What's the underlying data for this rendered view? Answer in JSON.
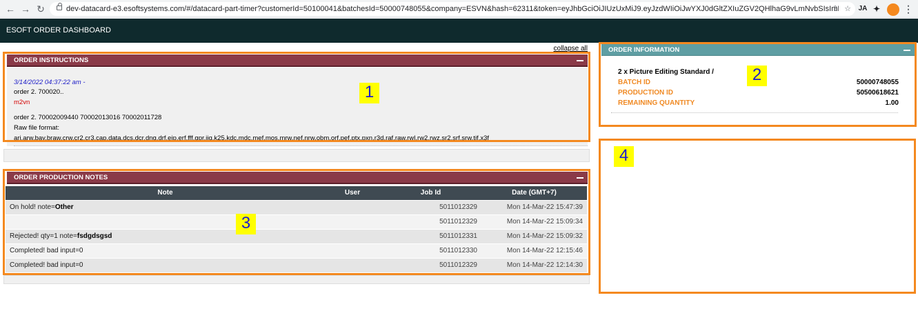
{
  "browser": {
    "url": "dev-datacard-e3.esoftsystems.com/#/datacard-part-timer?customerId=50100041&batchesId=50000748055&company=ESVN&hash=62311&token=eyJhbGciOiJIUzUxMiJ9.eyJzdWIiOiJwYXJ0dGltZXIuZGV2QHlhaG9vLmNvbSIsImF1ZCI...",
    "ext_label": "JA"
  },
  "app": {
    "title": "ESOFT ORDER DASHBOARD",
    "collapse_all": "collapse all"
  },
  "markers": {
    "m1": "1",
    "m2": "2",
    "m3": "3",
    "m4": "4"
  },
  "instructions": {
    "header": "Order Instructions",
    "timestamp": "3/14/2022 04:37:22 am -",
    "line1": "order 2. 700020..",
    "author": "m2vn",
    "line2": "order 2. 70002009440 70002013016 70002011728",
    "line3": "Raw file format:",
    "line4": "ari,arw,bay,braw,crw,cr2,cr3,cap,data,dcs,dcr,dng,drf,eip,erf,fff,gpr,iiq,k25,kdc,mdc,mef,mos,mrw,nef,nrw,obm,orf,pef,ptx,pxn,r3d,raf,raw,rwl,rw2,rwz,sr2,srf,srw,tif,x3f"
  },
  "notes": {
    "header": "Order Production Notes",
    "columns": {
      "note": "Note",
      "user": "User",
      "job": "Job Id",
      "date": "Date (GMT+7)"
    },
    "rows": [
      {
        "prefix": "On hold! note=",
        "bold": "Other",
        "user": "",
        "job": "5011012329",
        "date": "Mon 14-Mar-22 15:47:39"
      },
      {
        "prefix": "",
        "bold": "",
        "user": "",
        "job": "5011012329",
        "date": "Mon 14-Mar-22 15:09:34"
      },
      {
        "prefix": "Rejected! qty=1 note=",
        "bold": "fsdgdsgsd",
        "user": "",
        "job": "5011012331",
        "date": "Mon 14-Mar-22 15:09:32"
      },
      {
        "prefix": "Completed! bad input=0",
        "bold": "",
        "user": "",
        "job": "5011012330",
        "date": "Mon 14-Mar-22 12:15:46"
      },
      {
        "prefix": "Completed! bad input=0",
        "bold": "",
        "user": "",
        "job": "5011012329",
        "date": "Mon 14-Mar-22 12:14:30"
      }
    ]
  },
  "info": {
    "header": "Order Information",
    "product": "2 x Picture Editing Standard /",
    "batch_label": "Batch ID",
    "batch_value": "50000748055",
    "production_label": "Production ID",
    "production_value": "50500618621",
    "remaining_label": "Remaining Quantity",
    "remaining_value": "1.00"
  },
  "colors": {
    "highlight": "#f4891f",
    "marker_bg": "#ffff00",
    "maroon_header": "#8a3a48",
    "teal_header": "#5f9ea3",
    "table_header": "#3f4a52",
    "label_orange": "#f08a24"
  }
}
